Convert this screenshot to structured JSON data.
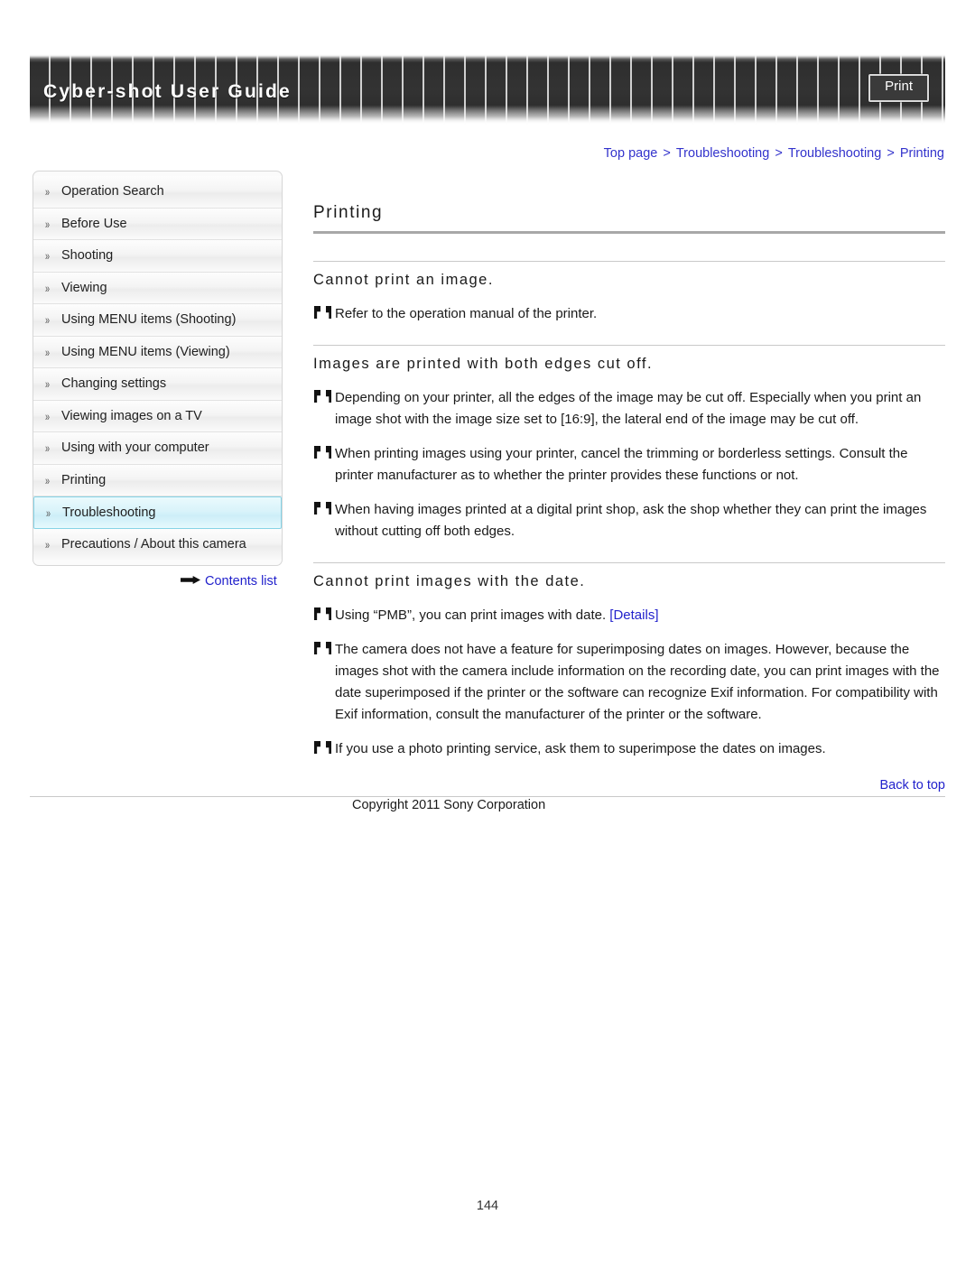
{
  "header": {
    "title": "Cyber-shot User Guide",
    "print_label": "Print"
  },
  "breadcrumb": {
    "separator": ">",
    "items": [
      {
        "label": "Top page"
      },
      {
        "label": "Troubleshooting"
      },
      {
        "label": "Troubleshooting"
      },
      {
        "label": "Printing"
      }
    ]
  },
  "sidebar": {
    "chevron_icon": "double-chevron-right-icon",
    "items": [
      {
        "label": "Operation Search",
        "selected": false
      },
      {
        "label": "Before Use",
        "selected": false
      },
      {
        "label": "Shooting",
        "selected": false
      },
      {
        "label": "Viewing",
        "selected": false
      },
      {
        "label": "Using MENU items (Shooting)",
        "selected": false
      },
      {
        "label": "Using MENU items (Viewing)",
        "selected": false
      },
      {
        "label": "Changing settings",
        "selected": false
      },
      {
        "label": "Viewing images on a TV",
        "selected": false
      },
      {
        "label": "Using with your computer",
        "selected": false
      },
      {
        "label": "Printing",
        "selected": false
      },
      {
        "label": "Troubleshooting",
        "selected": true
      },
      {
        "label": "Precautions / About this camera",
        "selected": false
      }
    ],
    "contents_list_label": "Contents list"
  },
  "main": {
    "page_title": "Printing",
    "sections": [
      {
        "heading": "Cannot print an image.",
        "bullets": [
          {
            "text": "Refer to the operation manual of the printer."
          }
        ]
      },
      {
        "heading": "Images are printed with both edges cut off.",
        "bullets": [
          {
            "text": "Depending on your printer, all the edges of the image may be cut off. Especially when you print an image shot with the image size set to [16:9], the lateral end of the image may be cut off."
          },
          {
            "text": "When printing images using your printer, cancel the trimming or borderless settings. Consult the printer manufacturer as to whether the printer provides these functions or not."
          },
          {
            "text": "When having images printed at a digital print shop, ask the shop whether they can print the images without cutting off both edges."
          }
        ]
      },
      {
        "heading": "Cannot print images with the date.",
        "bullets": [
          {
            "text": "Using “PMB”, you can print images with date. ",
            "link": "[Details]"
          },
          {
            "text": "The camera does not have a feature for superimposing dates on images. However, because the images shot with the camera include information on the recording date, you can print images with the date superimposed if the printer or the software can recognize Exif information. For compatibility with Exif information, consult the manufacturer of the printer or the software."
          },
          {
            "text": "If you use a photo printing service, ask them to superimpose the dates on images."
          }
        ]
      }
    ]
  },
  "footer": {
    "back_to_top_label": "Back to top",
    "copyright": "Copyright 2011 Sony Corporation",
    "page_number": "144"
  },
  "colors": {
    "link": "#2222CC",
    "breadcrumb_link": "#3333CC",
    "selected_nav_border": "#86D3E6",
    "rule": "#C9C9C9"
  }
}
